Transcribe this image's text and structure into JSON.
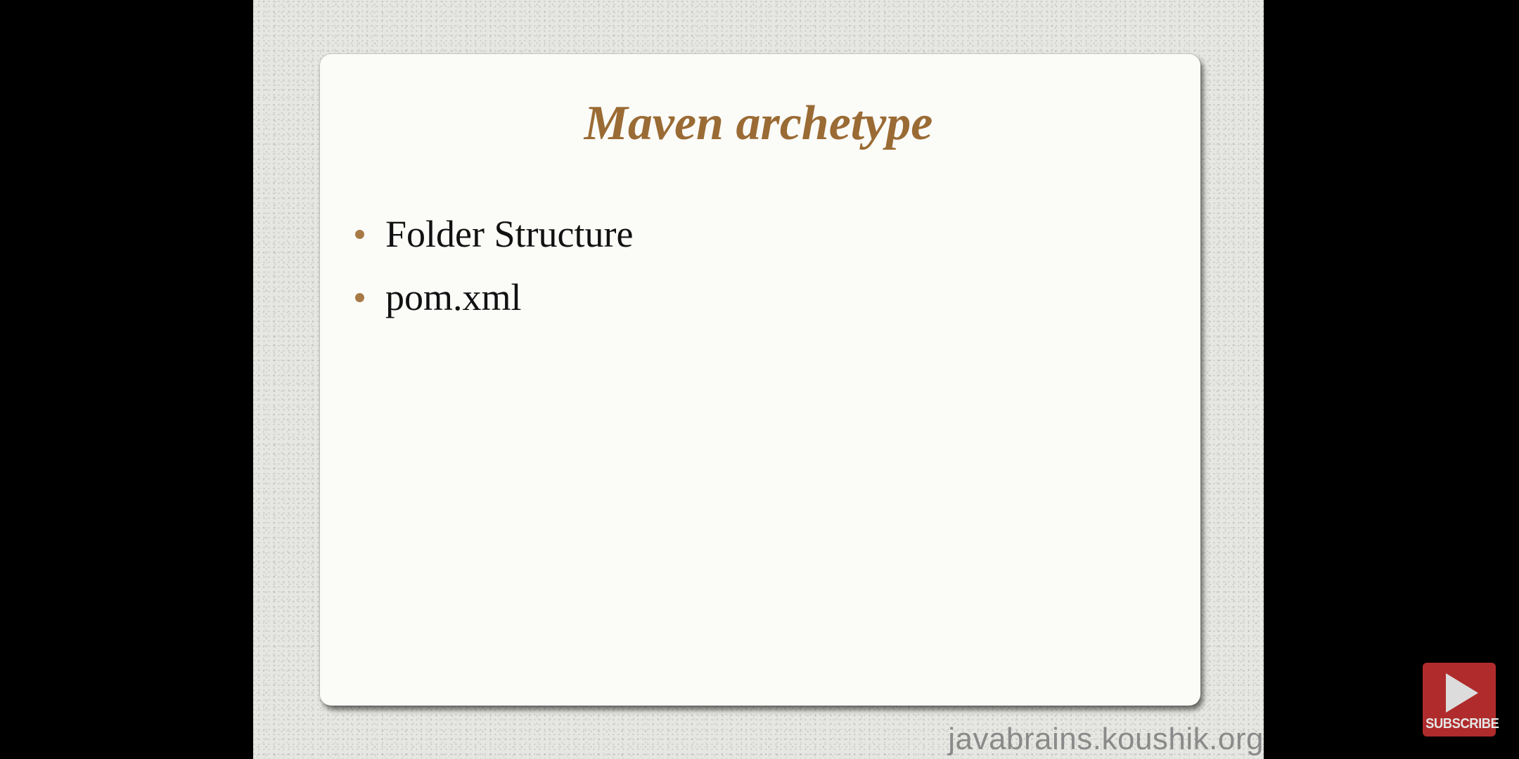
{
  "slide": {
    "title": "Maven archetype",
    "bullets": [
      "Folder Structure",
      "pom.xml"
    ]
  },
  "watermark": "javabrains.koushik.org",
  "subscribe": {
    "label": "SUBSCRIBE",
    "icon": "play-icon"
  },
  "colors": {
    "title": "#9a6b34",
    "bullet": "#a77a45",
    "subscribe_bg": "#b02b2b"
  }
}
